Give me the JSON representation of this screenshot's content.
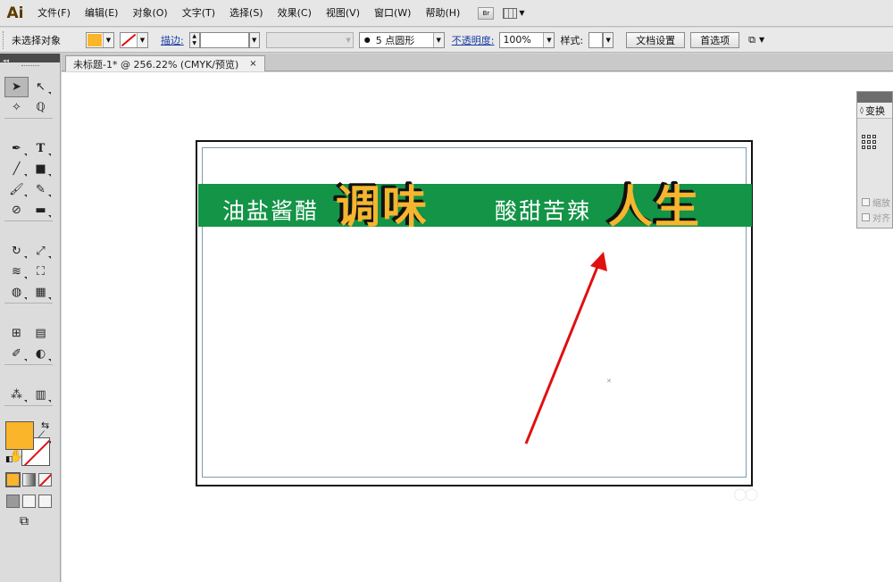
{
  "app": {
    "logo": "Ai"
  },
  "menubar": {
    "items": [
      "文件(F)",
      "编辑(E)",
      "对象(O)",
      "文字(T)",
      "选择(S)",
      "效果(C)",
      "视图(V)",
      "窗口(W)",
      "帮助(H)"
    ],
    "bridge_label": "Br"
  },
  "controlbar": {
    "selection_label": "未选择对象",
    "fill_color": "#fbb52b",
    "stroke_label": "描边:",
    "brush_label": "5 点圆形",
    "opacity_label": "不透明度:",
    "opacity_value": "100%",
    "style_label": "样式:",
    "doc_setup_button": "文档设置",
    "preferences_button": "首选项"
  },
  "document": {
    "tab_title": "未标题-1* @ 256.22% (CMYK/预览)",
    "tab_close": "×"
  },
  "artwork": {
    "banner_color": "#139447",
    "text_1_small": "油盐酱醋",
    "text_1_big": "调味",
    "text_2_small": "酸甜苦辣",
    "text_2_big": "人生",
    "big_text_color": "#f6b52e",
    "arrow_color": "#e01010"
  },
  "panels": {
    "transform_tab": "变换",
    "check_1": "缩放",
    "check_2": "对齐"
  },
  "tools": {
    "fill_color": "#fbb52b",
    "icons": [
      "selection-icon",
      "direct-selection-icon",
      "magic-wand-icon",
      "lasso-icon",
      "pen-icon",
      "type-icon",
      "line-icon",
      "rectangle-icon",
      "paintbrush-icon",
      "pencil-icon",
      "blob-brush-icon",
      "eraser-icon",
      "rotate-icon",
      "scale-icon",
      "width-icon",
      "free-transform-icon",
      "shape-builder-icon",
      "perspective-grid-icon",
      "mesh-icon",
      "gradient-icon",
      "eyedropper-icon",
      "blend-icon",
      "symbol-sprayer-icon",
      "column-graph-icon",
      "artboard-icon",
      "slice-icon",
      "hand-icon",
      "zoom-icon"
    ]
  }
}
